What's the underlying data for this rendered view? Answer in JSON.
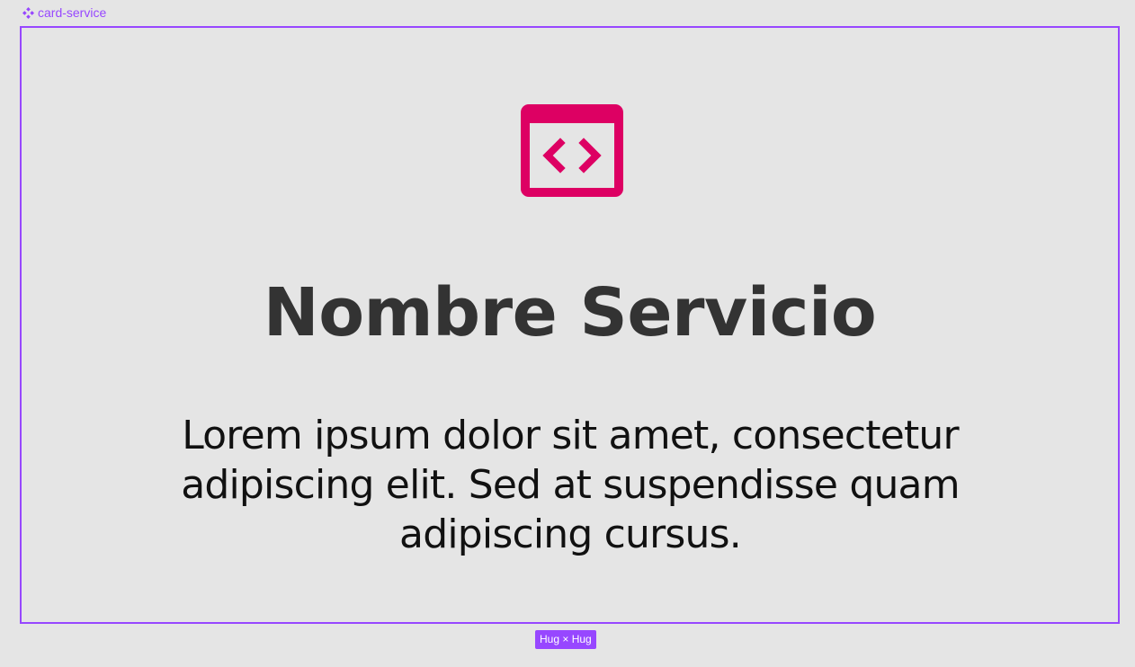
{
  "component": {
    "label": "card-service",
    "icon": "component-icon"
  },
  "card": {
    "icon": "code-window-icon",
    "title": "Nombre Servicio",
    "description": "Lorem ipsum dolor sit amet, consectetur adipiscing elit. Sed at suspendisse quam adipiscing cursus."
  },
  "sizing_badge": "Hug × Hug",
  "colors": {
    "background": "#e5e5e5",
    "selection": "#9747ff",
    "icon_accent": "#dd0063",
    "title_text": "#333333",
    "body_text": "#111111"
  }
}
